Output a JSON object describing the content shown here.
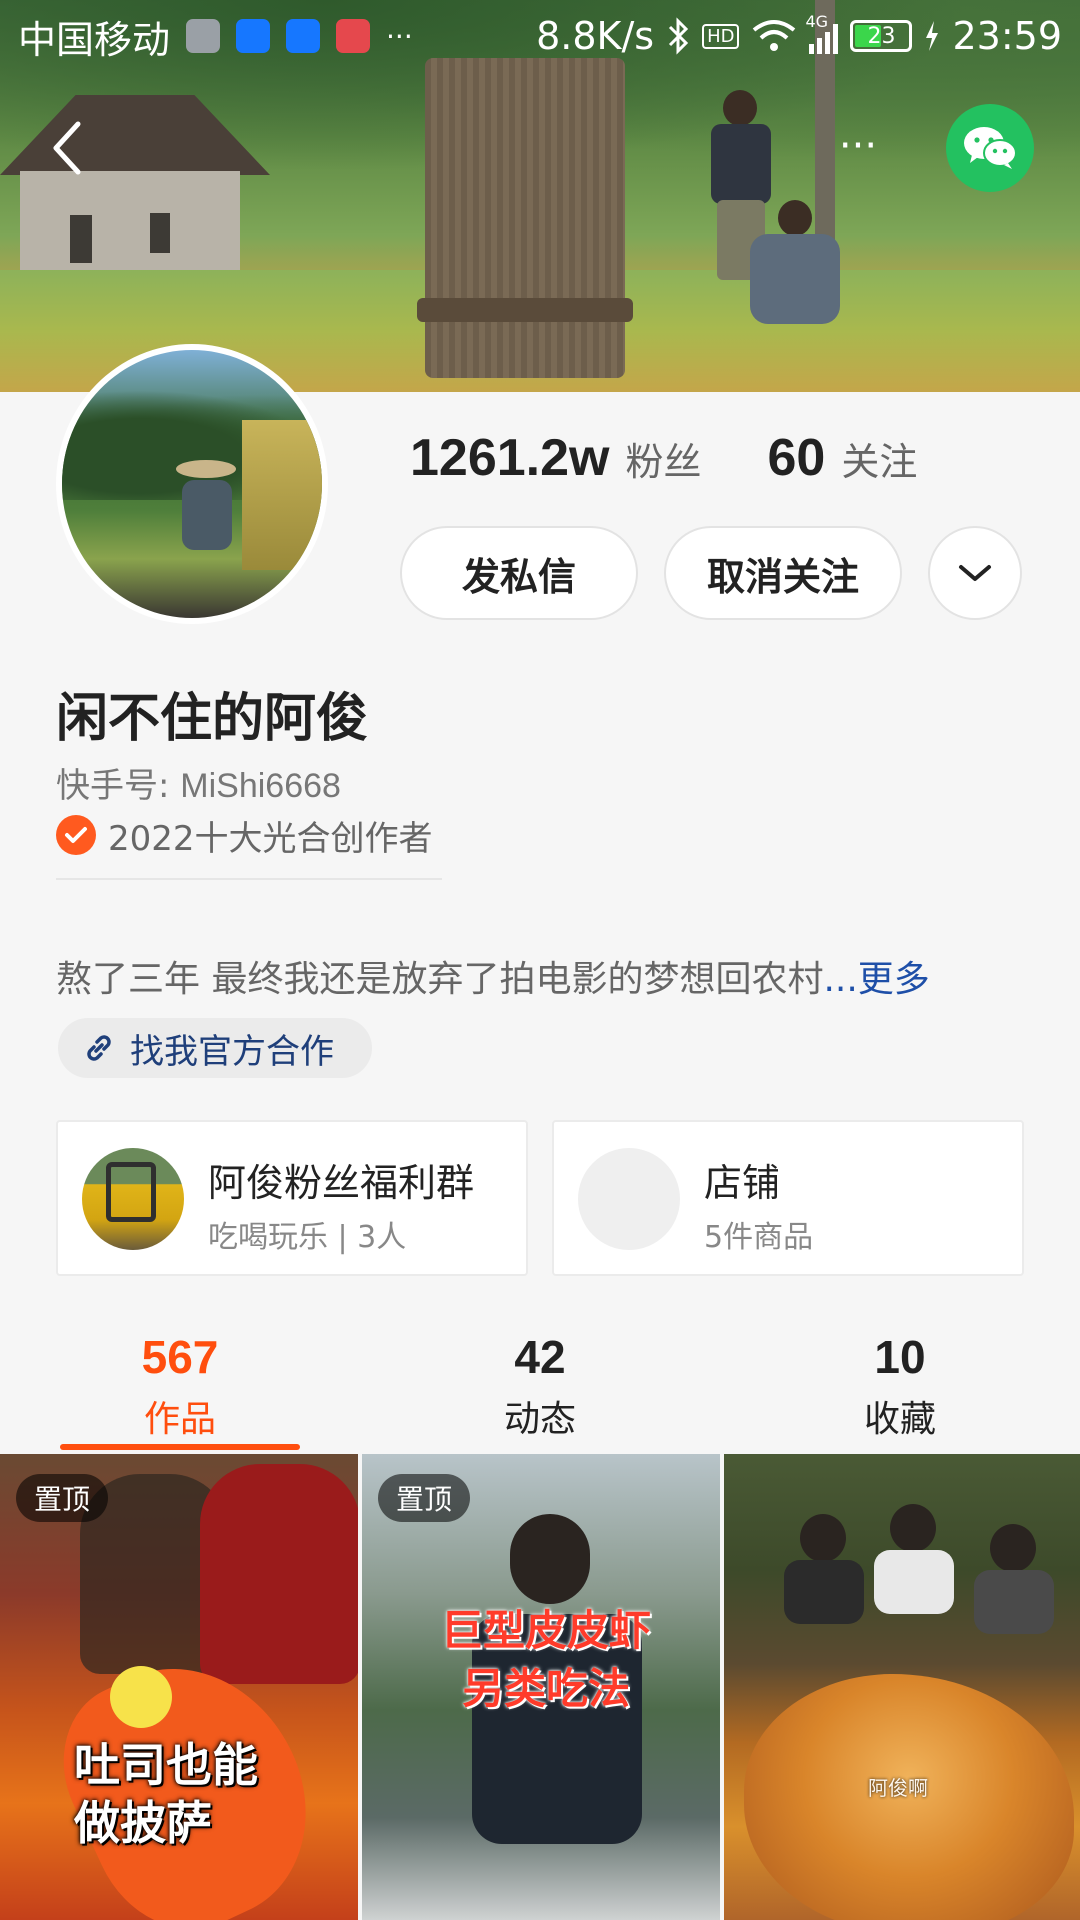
{
  "status_bar": {
    "carrier": "中国移动",
    "more": "···",
    "speed": "8.8K/s",
    "hd": "HD",
    "network": "4G",
    "battery": "23",
    "time": "23:59"
  },
  "header": {
    "more_label": "···",
    "wechat_color": "#23c160"
  },
  "profile": {
    "followers_count": "1261.2w",
    "followers_label": "粉丝",
    "following_count": "60",
    "following_label": "关注",
    "message_button": "发私信",
    "unfollow_button": "取消关注",
    "name": "闲不住的阿俊",
    "kuaishou_id_label": "快手号: ",
    "kuaishou_id": "MiShi6668",
    "honor": "2022十大光合创作者",
    "bio": "熬了三年 最终我还是放弃了拍电影的梦想回农村",
    "bio_ellipsis": "...",
    "bio_more": "更多",
    "cooperation_link": "找我官方合作"
  },
  "cards": {
    "fans_group_title": "阿俊粉丝福利群",
    "fans_group_subtitle": "吃喝玩乐 | 3人",
    "shop_title": "店铺",
    "shop_subtitle": "5件商品"
  },
  "tabs": [
    {
      "count": "567",
      "label": "作品",
      "active": true
    },
    {
      "count": "42",
      "label": "动态",
      "active": false
    },
    {
      "count": "10",
      "label": "收藏",
      "active": false
    }
  ],
  "videos": [
    {
      "pinned_label": "置顶",
      "caption_line1": "吐司也能",
      "caption_line2": "做披萨"
    },
    {
      "pinned_label": "置顶",
      "caption_line1": "巨型皮皮虾",
      "caption_line2": "另类吃法"
    },
    {
      "watermark": "阿俊啊"
    }
  ],
  "colors": {
    "accent": "#ff4e0e",
    "honor_badge": "#ff5a1f",
    "link": "#1e4fa8"
  }
}
